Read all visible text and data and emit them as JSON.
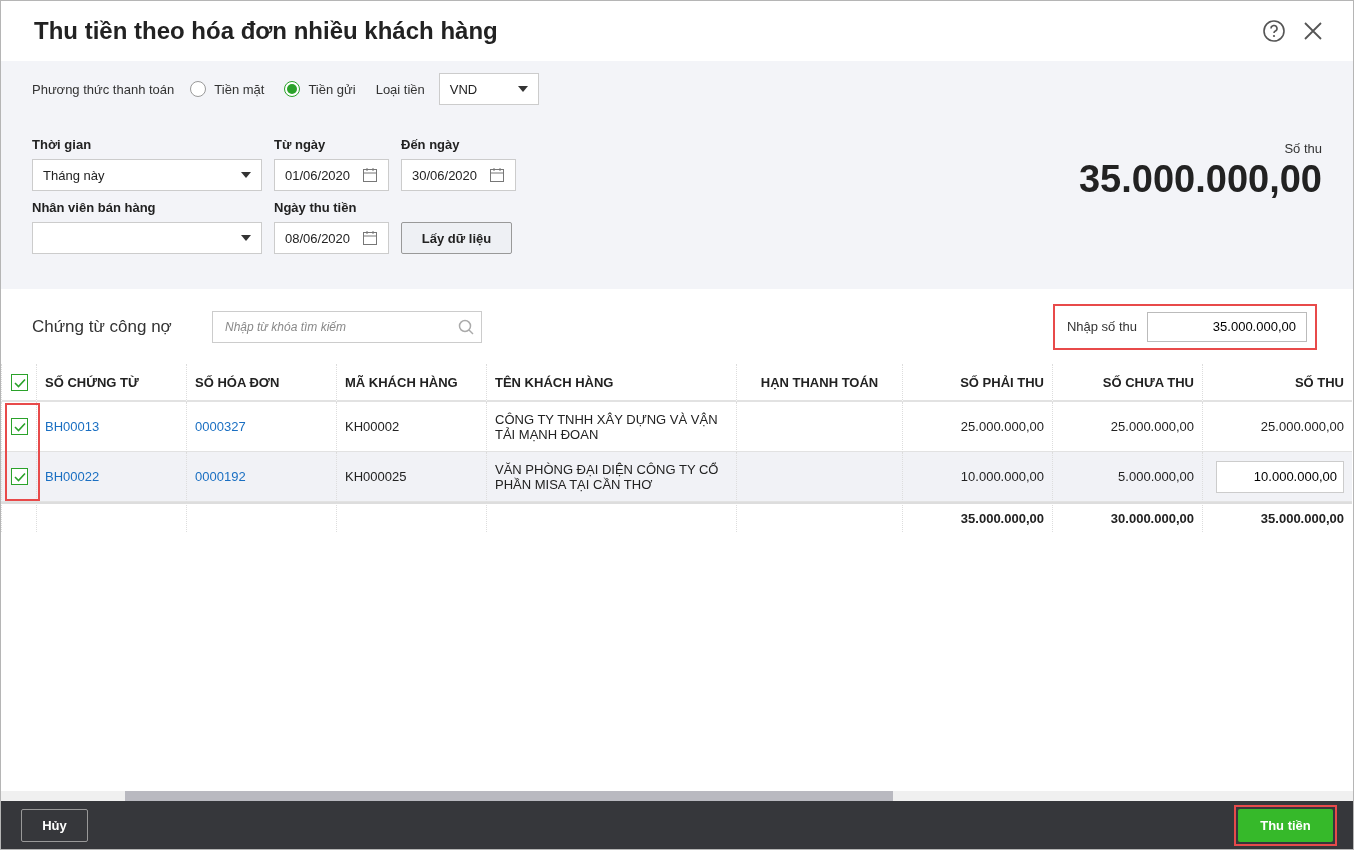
{
  "dialog": {
    "title": "Thu tiền theo hóa đơn nhiều khách hàng"
  },
  "payment": {
    "label": "Phương thức thanh toán",
    "options": [
      {
        "label": "Tiền mặt",
        "selected": false
      },
      {
        "label": "Tiền gửi",
        "selected": true
      }
    ],
    "currency_label": "Loại tiền",
    "currency": "VND"
  },
  "filters": [
    [
      {
        "kind": "select",
        "label": "Thời gian",
        "value": "Tháng này"
      },
      {
        "kind": "date",
        "label": "Từ ngày",
        "value": "01/06/2020"
      },
      {
        "kind": "date",
        "label": "Đến ngày",
        "value": "30/06/2020"
      }
    ],
    [
      {
        "kind": "select",
        "label": "Nhân viên bán hàng"
      },
      {
        "kind": "date",
        "label": "Ngày thu tiền",
        "value": "08/06/2020"
      },
      {
        "kind": "button",
        "value": "Lấy dữ liệu"
      }
    ]
  ],
  "total": {
    "label": "Số thu",
    "amount": "35.000.000,00"
  },
  "section": {
    "title": "Chứng từ công nợ",
    "search_placeholder": "Nhập từ khóa tìm kiếm",
    "receipt_label": "Nhập số thu",
    "receipt_value": "35.000.000,00",
    "highlighted": true
  },
  "table": {
    "all_checked": true,
    "checkbox_column_highlighted": true,
    "columns": [
      {
        "label": "SỐ CHỨNG TỪ",
        "kind": "link"
      },
      {
        "label": "SỐ HÓA ĐƠN",
        "kind": "link"
      },
      {
        "label": "MÃ KHÁCH HÀNG",
        "kind": "text"
      },
      {
        "label": "TÊN KHÁCH HÀNG",
        "kind": "text"
      },
      {
        "label": "HẠN THANH TOÁN",
        "kind": "date"
      },
      {
        "label": "SỐ PHẢI THU",
        "kind": "number"
      },
      {
        "label": "SỐ CHƯA THU",
        "kind": "number"
      },
      {
        "label": "SỐ THU",
        "kind": "number"
      }
    ],
    "rows": [
      {
        "checked": true,
        "focused": false,
        "cells": [
          "BH00013",
          "0000327",
          "KH00002",
          "CÔNG TY TNHH XÂY DỰNG VÀ VẬN TẢI MẠNH ĐOAN",
          "",
          "25.000.000,00",
          "25.000.000,00",
          "25.000.000,00"
        ]
      },
      {
        "checked": true,
        "focused": true,
        "cells": [
          "BH00022",
          "0000192",
          "KH000025",
          "VĂN PHÒNG ĐẠI DIỆN CÔNG TY CỔ PHẦN MISA TẠI CẦN THƠ",
          "",
          "10.000.000,00",
          "5.000.000,00",
          "10.000.000,00"
        ]
      }
    ],
    "totals": [
      "35.000.000,00",
      "30.000.000,00",
      "35.000.000,00"
    ]
  },
  "footer": {
    "buttons": [
      {
        "label": "Hủy",
        "kind": "secondary",
        "highlighted": false
      },
      {
        "label": "Thu tiền",
        "kind": "primary",
        "highlighted": true
      }
    ]
  }
}
